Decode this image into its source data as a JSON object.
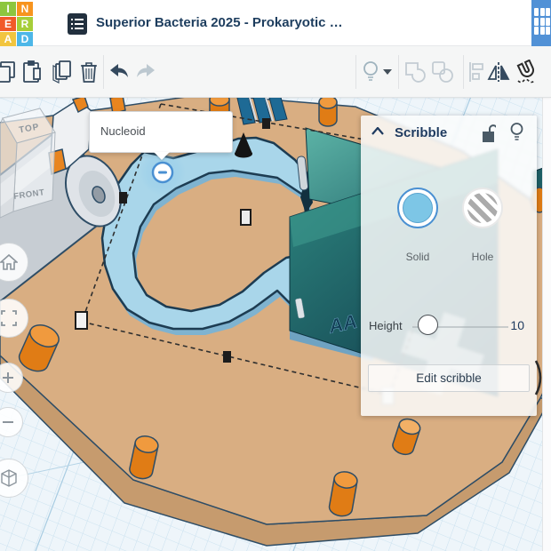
{
  "titlebar": {
    "title": "Superior Bacteria 2025 - Prokaryotic …",
    "logo_letters": [
      "I",
      "N",
      "E",
      "R",
      "A",
      "D"
    ],
    "logo_colors": [
      "#8dc63f",
      "#f7941e",
      "#f15a29",
      "#a6ce39",
      "#f2c53f",
      "#4db7e8"
    ]
  },
  "toolbar": {
    "icons_left": [
      "copy",
      "paste",
      "duplicate",
      "delete",
      "undo",
      "redo"
    ],
    "icons_right": [
      "shape-generators-bulb",
      "dropdown-caret",
      "group",
      "ungroup",
      "align",
      "mirror",
      "magnet"
    ]
  },
  "tooltip": {
    "text": "Nucleoid"
  },
  "panel": {
    "title": "Scribble",
    "solid_label": "Solid",
    "hole_label": "Hole",
    "height_label": "Height",
    "height_value": "10",
    "edit_button": "Edit scribble"
  },
  "viewcube": {
    "top": "TOP",
    "front": "FRONT"
  },
  "canvas": {
    "box_text": "AA"
  },
  "colors": {
    "accent_blue": "#4a90d2",
    "workplane_tan": "#d9ae82",
    "workplane_rim": "#c69b6e",
    "scribble_blue": "#a9d6ea",
    "scribble_shadow": "#7fb3d0",
    "outline_navy": "#24435c",
    "teal_box_light": "#55b0a3",
    "teal_box_dark": "#123f4d",
    "peg_orange": "#e07c15",
    "grid_line": "#c9e0ef",
    "apps_button": "#5191d6"
  }
}
